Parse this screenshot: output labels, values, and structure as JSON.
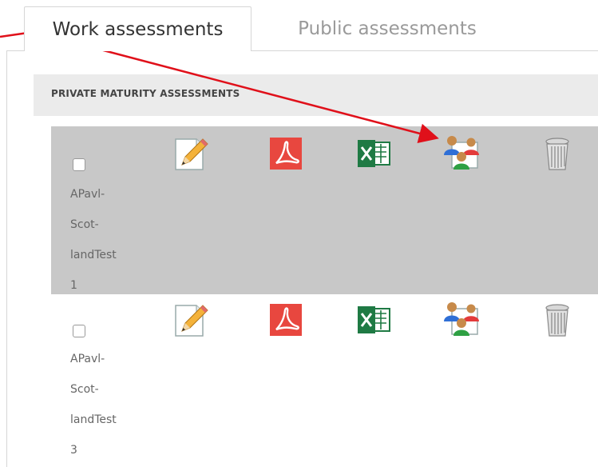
{
  "tabs": [
    {
      "label": "Work assessments",
      "active": true
    },
    {
      "label": "Public assessments",
      "active": false
    }
  ],
  "section": {
    "title": "PRIVATE MATURITY ASSESSMENTS"
  },
  "rows": [
    {
      "lines": [
        "APavl-",
        "Scot-",
        "landTest",
        "1"
      ],
      "selected": true,
      "checked": false
    },
    {
      "lines": [
        "APavl-",
        "Scot-",
        "landTest",
        "3"
      ],
      "selected": false,
      "checked": false
    }
  ],
  "icons": [
    "edit-pencil-icon",
    "pdf-icon",
    "excel-icon",
    "share-users-icon",
    "trash-icon"
  ],
  "colors": {
    "annotation_arrow": "#e0101a",
    "selected_row": "#c8c8c8",
    "pdf": "#e8473f",
    "excel": "#1f7a44"
  }
}
